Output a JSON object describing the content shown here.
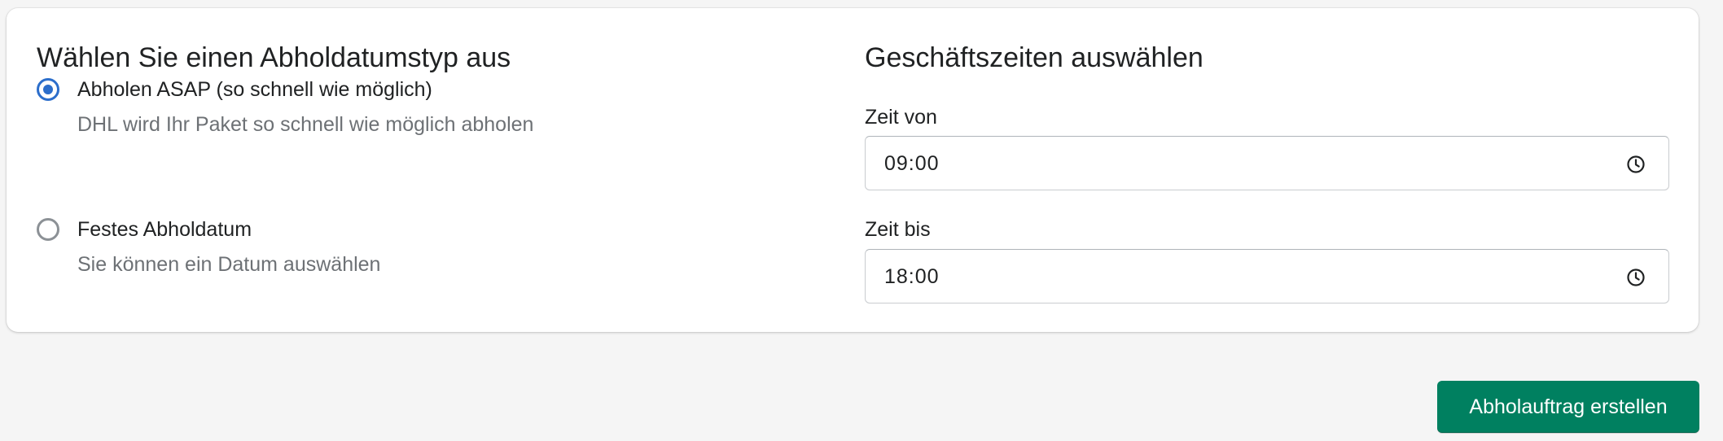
{
  "pickup_type": {
    "title": "Wählen Sie einen Abholdatumstyp aus",
    "options": [
      {
        "label": "Abholen ASAP (so schnell wie möglich)",
        "help": "DHL wird Ihr Paket so schnell wie möglich abholen",
        "selected": true
      },
      {
        "label": "Festes Abholdatum",
        "help": "Sie können ein Datum auswählen",
        "selected": false
      }
    ]
  },
  "business_hours": {
    "title": "Geschäftszeiten auswählen",
    "time_from": {
      "label": "Zeit von",
      "value": "09:00",
      "icon": "clock-icon"
    },
    "time_to": {
      "label": "Zeit bis",
      "value": "18:00",
      "icon": "clock-icon"
    }
  },
  "actions": {
    "submit_label": "Abholauftrag erstellen"
  },
  "colors": {
    "accent": "#2c6ecb",
    "primary_button": "#008060",
    "page_background": "#f5f5f5",
    "card_background": "#ffffff"
  }
}
